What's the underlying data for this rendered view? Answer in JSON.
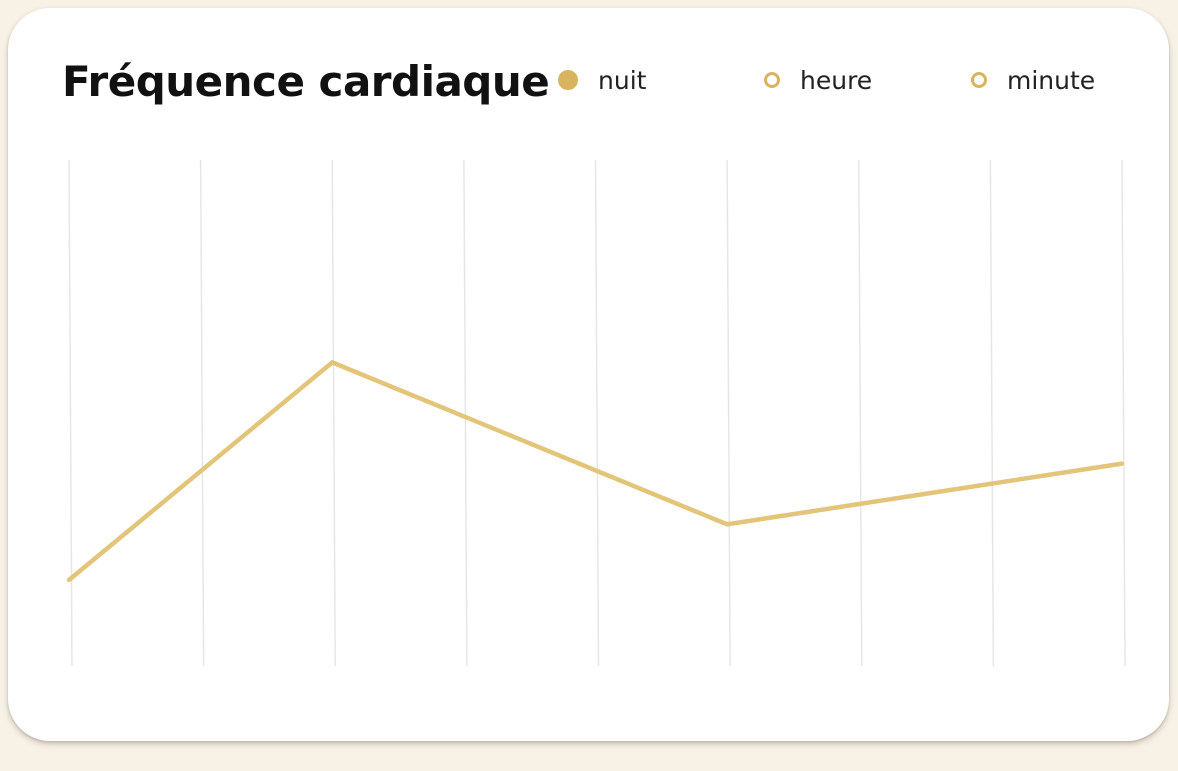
{
  "card": {
    "title": "Fréquence cardiaque"
  },
  "legend": {
    "items": [
      {
        "label": "nuit",
        "selected": true
      },
      {
        "label": "heure",
        "selected": false
      },
      {
        "label": "minute",
        "selected": false
      }
    ]
  },
  "colors": {
    "background": "#f8f1e6",
    "card": "#ffffff",
    "accent": "#d8b45f",
    "line": "#e3c57a",
    "grid": "#e6e6e6"
  },
  "chart_data": {
    "type": "line",
    "title": "Fréquence cardiaque",
    "xlabel": "",
    "ylabel": "",
    "grid": "vertical",
    "legend_placement": "top-right",
    "x": [
      0,
      1,
      2,
      3,
      4,
      5,
      6,
      7,
      8
    ],
    "series": [
      {
        "name": "nuit",
        "x": [
          0,
          2,
          5,
          8
        ],
        "values": [
          0.17,
          0.6,
          0.28,
          0.4
        ]
      }
    ],
    "ylim": [
      0,
      1
    ]
  }
}
